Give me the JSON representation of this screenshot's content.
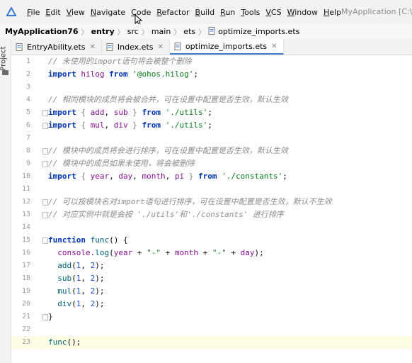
{
  "menubar": {
    "items": [
      {
        "key": "F",
        "rest": "ile"
      },
      {
        "key": "E",
        "rest": "dit"
      },
      {
        "key": "V",
        "rest": "iew"
      },
      {
        "key": "N",
        "rest": "avigate"
      },
      {
        "key": "C",
        "rest": "ode"
      },
      {
        "key": "R",
        "rest": "efactor"
      },
      {
        "key": "B",
        "rest": "uild"
      },
      {
        "key": "R",
        "rest": "un"
      },
      {
        "key": "T",
        "rest": "ools"
      },
      {
        "key": "V",
        "rest": "CS"
      },
      {
        "key": "W",
        "rest": "indow"
      },
      {
        "key": "H",
        "rest": "elp"
      }
    ],
    "window_title": "MyApplication [C:\\Us"
  },
  "breadcrumb": {
    "project": "MyApplication76",
    "items": [
      "entry",
      "src",
      "main",
      "ets",
      "optimize_imports.ets"
    ]
  },
  "left_strip": {
    "label": "Project"
  },
  "tabs": [
    {
      "label": "EntryAbility.ets",
      "active": false
    },
    {
      "label": "Index.ets",
      "active": false
    },
    {
      "label": "optimize_imports.ets",
      "active": true
    }
  ],
  "editor": {
    "current_line": 23,
    "lines": [
      {
        "n": "1",
        "tokens": [
          [
            "c",
            "// 未使用的import语句将会被整个删除"
          ]
        ]
      },
      {
        "n": "2",
        "tokens": [
          [
            "k",
            "import"
          ],
          [
            "p",
            " "
          ],
          [
            "i",
            "hilog"
          ],
          [
            "p",
            " "
          ],
          [
            "k",
            "from"
          ],
          [
            "p",
            " "
          ],
          [
            "s",
            "'@ohos.hilog'"
          ],
          [
            "p",
            ";"
          ]
        ]
      },
      {
        "n": "3",
        "tokens": []
      },
      {
        "n": "4",
        "tokens": [
          [
            "c",
            "// 相同模块的成员将会被合并，可在设置中配置是否生效，默认生效"
          ]
        ]
      },
      {
        "n": "5",
        "fold": true,
        "tokens": [
          [
            "k",
            "import"
          ],
          [
            "p",
            " "
          ],
          [
            "b",
            "{"
          ],
          [
            "p",
            " "
          ],
          [
            "i",
            "add"
          ],
          [
            "p",
            ", "
          ],
          [
            "i",
            "sub"
          ],
          [
            "p",
            " "
          ],
          [
            "b",
            "}"
          ],
          [
            "p",
            " "
          ],
          [
            "k",
            "from"
          ],
          [
            "p",
            " "
          ],
          [
            "s",
            "'./utils'"
          ],
          [
            "p",
            ";"
          ]
        ]
      },
      {
        "n": "6",
        "fold": true,
        "tokens": [
          [
            "k",
            "import"
          ],
          [
            "p",
            " "
          ],
          [
            "b",
            "{"
          ],
          [
            "p",
            " "
          ],
          [
            "i",
            "mul"
          ],
          [
            "p",
            ", "
          ],
          [
            "i",
            "div"
          ],
          [
            "p",
            " "
          ],
          [
            "b",
            "}"
          ],
          [
            "p",
            " "
          ],
          [
            "k",
            "from"
          ],
          [
            "p",
            " "
          ],
          [
            "s",
            "'./utils'"
          ],
          [
            "p",
            ";"
          ]
        ]
      },
      {
        "n": "7",
        "tokens": []
      },
      {
        "n": "8",
        "fold": true,
        "tokens": [
          [
            "c",
            "// 模块中的成员将会进行排序，可在设置中配置是否生效，默认生效"
          ]
        ]
      },
      {
        "n": "9",
        "fold": true,
        "tokens": [
          [
            "c",
            "// 模块中的成员如果未使用，将会被删除"
          ]
        ]
      },
      {
        "n": "10",
        "tokens": [
          [
            "k",
            "import"
          ],
          [
            "p",
            " "
          ],
          [
            "b",
            "{"
          ],
          [
            "p",
            " "
          ],
          [
            "i",
            "year"
          ],
          [
            "p",
            ", "
          ],
          [
            "i",
            "day"
          ],
          [
            "p",
            ", "
          ],
          [
            "i",
            "month"
          ],
          [
            "p",
            ", "
          ],
          [
            "i",
            "pi"
          ],
          [
            "p",
            " "
          ],
          [
            "b",
            "}"
          ],
          [
            "p",
            " "
          ],
          [
            "k",
            "from"
          ],
          [
            "p",
            " "
          ],
          [
            "s",
            "'./constants'"
          ],
          [
            "p",
            ";"
          ]
        ]
      },
      {
        "n": "11",
        "tokens": []
      },
      {
        "n": "12",
        "fold": true,
        "tokens": [
          [
            "c",
            "// 可以按模块名对import语句进行排序，可在设置中配置是否生效，默认不生效"
          ]
        ]
      },
      {
        "n": "13",
        "fold": true,
        "tokens": [
          [
            "c",
            "// 对应实例中就是会按 './utils'和'./constants' 进行排序"
          ]
        ]
      },
      {
        "n": "14",
        "tokens": []
      },
      {
        "n": "15",
        "fold": true,
        "tokens": [
          [
            "k",
            "function"
          ],
          [
            "p",
            " "
          ],
          [
            "f",
            "func"
          ],
          [
            "p",
            "() {"
          ]
        ]
      },
      {
        "n": "16",
        "tokens": [
          [
            "p",
            "  "
          ],
          [
            "i",
            "console"
          ],
          [
            "p",
            "."
          ],
          [
            "f",
            "log"
          ],
          [
            "p",
            "("
          ],
          [
            "i",
            "year"
          ],
          [
            "p",
            " + "
          ],
          [
            "s",
            "\"-\""
          ],
          [
            "p",
            " + "
          ],
          [
            "i",
            "month"
          ],
          [
            "p",
            " + "
          ],
          [
            "s",
            "\"-\""
          ],
          [
            "p",
            " + "
          ],
          [
            "i",
            "day"
          ],
          [
            "p",
            ");"
          ]
        ]
      },
      {
        "n": "17",
        "tokens": [
          [
            "p",
            "  "
          ],
          [
            "f",
            "add"
          ],
          [
            "p",
            "("
          ],
          [
            "n",
            "1"
          ],
          [
            "p",
            ", "
          ],
          [
            "n",
            "2"
          ],
          [
            "p",
            ");"
          ]
        ]
      },
      {
        "n": "18",
        "tokens": [
          [
            "p",
            "  "
          ],
          [
            "f",
            "sub"
          ],
          [
            "p",
            "("
          ],
          [
            "n",
            "1"
          ],
          [
            "p",
            ", "
          ],
          [
            "n",
            "2"
          ],
          [
            "p",
            ");"
          ]
        ]
      },
      {
        "n": "19",
        "tokens": [
          [
            "p",
            "  "
          ],
          [
            "f",
            "mul"
          ],
          [
            "p",
            "("
          ],
          [
            "n",
            "1"
          ],
          [
            "p",
            ", "
          ],
          [
            "n",
            "2"
          ],
          [
            "p",
            ");"
          ]
        ]
      },
      {
        "n": "20",
        "tokens": [
          [
            "p",
            "  "
          ],
          [
            "f",
            "div"
          ],
          [
            "p",
            "("
          ],
          [
            "n",
            "1"
          ],
          [
            "p",
            ", "
          ],
          [
            "n",
            "2"
          ],
          [
            "p",
            ");"
          ]
        ]
      },
      {
        "n": "21",
        "fold": true,
        "tokens": [
          [
            "p",
            "}"
          ]
        ]
      },
      {
        "n": "22",
        "tokens": []
      },
      {
        "n": "23",
        "tokens": [
          [
            "f",
            "func"
          ],
          [
            "p",
            "();"
          ]
        ]
      }
    ]
  },
  "colors": {
    "keyword": "#0033b3",
    "string": "#067d17",
    "comment": "#8c8c8c",
    "identifier": "#871094",
    "number": "#1750eb",
    "function": "#00627a",
    "active_tab_underline": "#4083c9"
  },
  "icons": {
    "app": "devstudio-logo-icon",
    "file": "ets-file-icon",
    "folder": "folder-icon"
  }
}
